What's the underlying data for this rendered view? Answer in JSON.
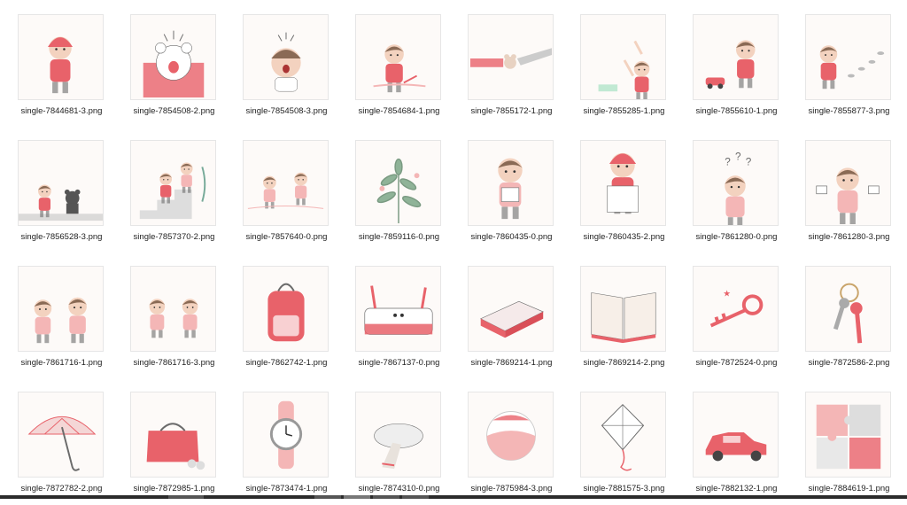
{
  "files": [
    {
      "name": "single-7844681-3.png",
      "icon": "child-red-hat-icon"
    },
    {
      "name": "single-7854508-2.png",
      "icon": "bear-peeking-icon"
    },
    {
      "name": "single-7854508-3.png",
      "icon": "crying-baby-icon"
    },
    {
      "name": "single-7854684-1.png",
      "icon": "child-drawing-icon"
    },
    {
      "name": "single-7855172-1.png",
      "icon": "hands-holding-toy-icon"
    },
    {
      "name": "single-7855285-1.png",
      "icon": "children-reaching-icon"
    },
    {
      "name": "single-7855610-1.png",
      "icon": "child-toy-car-icon"
    },
    {
      "name": "single-7855877-3.png",
      "icon": "child-footprints-icon"
    },
    {
      "name": "single-7856528-3.png",
      "icon": "child-and-bear-icon"
    },
    {
      "name": "single-7857370-2.png",
      "icon": "children-on-stairs-icon"
    },
    {
      "name": "single-7857640-0.png",
      "icon": "children-running-icon"
    },
    {
      "name": "single-7859116-0.png",
      "icon": "plants-icon"
    },
    {
      "name": "single-7860435-0.png",
      "icon": "child-with-paper-icon"
    },
    {
      "name": "single-7860435-2.png",
      "icon": "child-with-box-icon"
    },
    {
      "name": "single-7861280-0.png",
      "icon": "confused-child-icon"
    },
    {
      "name": "single-7861280-3.png",
      "icon": "child-with-cups-icon"
    },
    {
      "name": "single-7861716-1.png",
      "icon": "children-sharing-icon"
    },
    {
      "name": "single-7861716-3.png",
      "icon": "two-girls-icon"
    },
    {
      "name": "single-7862742-1.png",
      "icon": "backpack-icon"
    },
    {
      "name": "single-7867137-0.png",
      "icon": "pencil-case-icon"
    },
    {
      "name": "single-7869214-1.png",
      "icon": "closed-book-icon"
    },
    {
      "name": "single-7869214-2.png",
      "icon": "open-book-icon"
    },
    {
      "name": "single-7872524-0.png",
      "icon": "key-icon"
    },
    {
      "name": "single-7872586-2.png",
      "icon": "keys-on-ring-icon"
    },
    {
      "name": "single-7872782-2.png",
      "icon": "umbrella-icon"
    },
    {
      "name": "single-7872985-1.png",
      "icon": "purse-icon"
    },
    {
      "name": "single-7873474-1.png",
      "icon": "wristwatch-icon"
    },
    {
      "name": "single-7874310-0.png",
      "icon": "scarf-icon"
    },
    {
      "name": "single-7875984-3.png",
      "icon": "ball-icon"
    },
    {
      "name": "single-7881575-3.png",
      "icon": "kite-icon"
    },
    {
      "name": "single-7882132-1.png",
      "icon": "red-car-icon"
    },
    {
      "name": "single-7884619-1.png",
      "icon": "puzzle-icon"
    }
  ],
  "colors": {
    "accent": "#e8626a",
    "soft": "#f4b6b6",
    "skin": "#f3d2bf",
    "hair": "#8a6a55",
    "ink": "#6b6b6b"
  }
}
